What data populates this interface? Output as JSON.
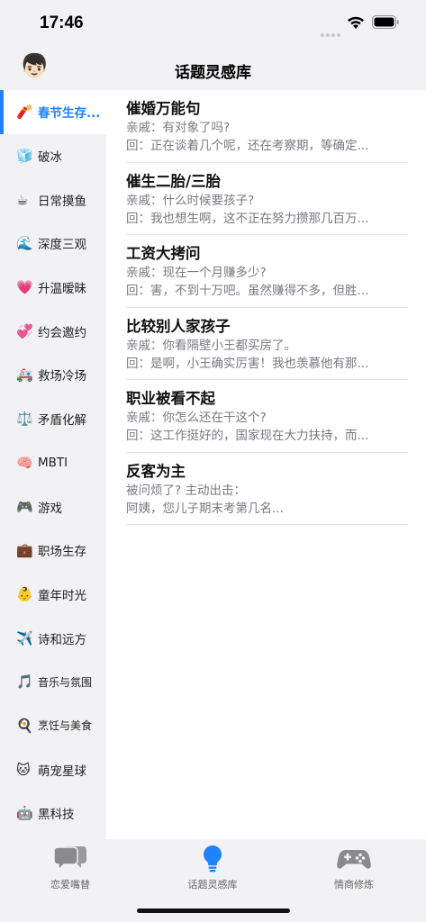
{
  "status": {
    "time": "17:46"
  },
  "nav": {
    "avatar_emoji": "👦🏻",
    "title": "话题灵感库"
  },
  "sidebar": {
    "items": [
      {
        "emoji": "🧨",
        "label": "春节生存...",
        "active": true
      },
      {
        "emoji": "🧊",
        "label": "破冰"
      },
      {
        "emoji": "☕",
        "label": "日常摸鱼"
      },
      {
        "emoji": "🌊",
        "label": "深度三观"
      },
      {
        "emoji": "💗",
        "label": "升温暧昧"
      },
      {
        "emoji": "💞",
        "label": "约会邀约"
      },
      {
        "emoji": "🚑",
        "label": "救场冷场"
      },
      {
        "emoji": "⚖️",
        "label": "矛盾化解"
      },
      {
        "emoji": "🧠",
        "label": "MBTI"
      },
      {
        "emoji": "🎮",
        "label": "游戏"
      },
      {
        "emoji": "💼",
        "label": "职场生存"
      },
      {
        "emoji": "👶",
        "label": "童年时光"
      },
      {
        "emoji": "✈️",
        "label": "诗和远方"
      },
      {
        "emoji": "🎵",
        "label": "音乐与氛围"
      },
      {
        "emoji": "🍳",
        "label": "烹饪与美食"
      },
      {
        "emoji": "🐱",
        "label": "萌宠星球"
      },
      {
        "emoji": "🤖",
        "label": "黑科技"
      }
    ]
  },
  "topics": [
    {
      "title": "催婚万能句",
      "line1": "亲戚：有对象了吗?",
      "line2": "回：正在谈着几个呢，还在考察期，等确定..."
    },
    {
      "title": "催生二胎/三胎",
      "line1": "亲戚：什么时候要孩子?",
      "line2": "回：我也想生啊，这不正在努力攒那几百万..."
    },
    {
      "title": "工资大拷问",
      "line1": "亲戚：现在一个月赚多少?",
      "line2": "回：害，不到十万吧。虽然赚得不多，但胜..."
    },
    {
      "title": "比较别人家孩子",
      "line1": "亲戚：你看隔壁小王都买房了。",
      "line2": "回：是啊，小王确实厉害！我也羡慕他有那..."
    },
    {
      "title": "职业被看不起",
      "line1": "亲戚：你怎么还在干这个?",
      "line2": "回：这工作挺好的，国家现在大力扶持，而..."
    },
    {
      "title": "反客为主",
      "line1": "被问烦了? 主动出击：",
      "line2": "阿姨，您儿子期末考第几名..."
    }
  ],
  "tabs": [
    {
      "label": "恋爱嘴替",
      "icon": "chat-bubbles-icon",
      "active": false
    },
    {
      "label": "话题灵感库",
      "icon": "lightbulb-icon",
      "active": true
    },
    {
      "label": "情商修炼",
      "icon": "gamepad-icon",
      "active": false
    }
  ],
  "colors": {
    "accent": "#1f82ff",
    "tab_inactive": "#8e8e93",
    "background": "#f2f2f4"
  }
}
